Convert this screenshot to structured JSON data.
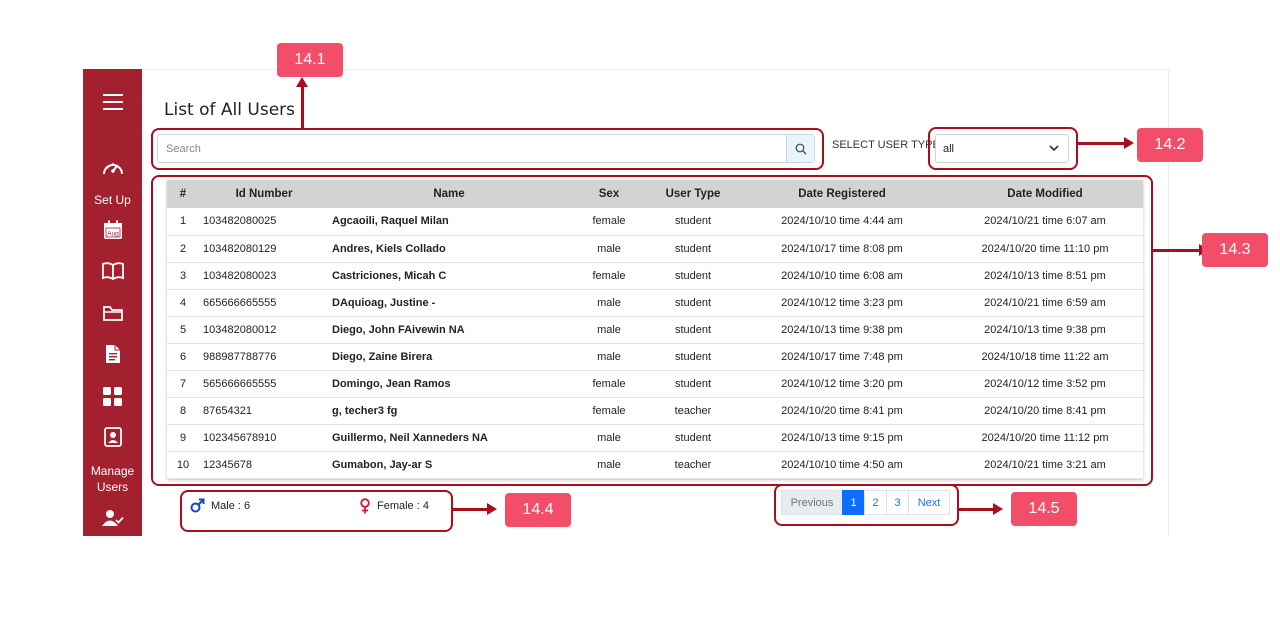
{
  "page": {
    "title": "List of All Users"
  },
  "search": {
    "placeholder": "Search"
  },
  "filter": {
    "label": "SELECT USER TYPE:",
    "selected": "all"
  },
  "sidebar": {
    "items": [
      {
        "icon": "menu-icon"
      },
      {
        "icon": "dashboard-gauge-icon",
        "label": "Set Up"
      },
      {
        "icon": "calendar-icon",
        "text": "Aug"
      },
      {
        "icon": "book-icon"
      },
      {
        "icon": "folder-icon"
      },
      {
        "icon": "document-icon"
      },
      {
        "icon": "grid-icon"
      },
      {
        "icon": "id-card-icon",
        "label": "Manage Users"
      },
      {
        "icon": "user-check-icon"
      }
    ],
    "setup_label": "Set Up",
    "calendar_text": "Aug",
    "manage_line1": "Manage",
    "manage_line2": "Users"
  },
  "table": {
    "headers": [
      "#",
      "Id Number",
      "Name",
      "Sex",
      "User Type",
      "Date Registered",
      "Date Modified"
    ],
    "rows": [
      [
        "1",
        "103482080025",
        "Agcaoili, Raquel Milan",
        "female",
        "student",
        "2024/10/10 time 4:44 am",
        "2024/10/21 time 6:07 am"
      ],
      [
        "2",
        "103482080129",
        "Andres, Kiels Collado",
        "male",
        "student",
        "2024/10/17 time 8:08 pm",
        "2024/10/20 time 11:10 pm"
      ],
      [
        "3",
        "103482080023",
        "Castriciones, Micah C",
        "female",
        "student",
        "2024/10/10 time 6:08 am",
        "2024/10/13 time 8:51 pm"
      ],
      [
        "4",
        "665666665555",
        "DAquioag, Justine -",
        "male",
        "student",
        "2024/10/12 time 3:23 pm",
        "2024/10/21 time 6:59 am"
      ],
      [
        "5",
        "103482080012",
        "Diego, John FAivewin NA",
        "male",
        "student",
        "2024/10/13 time 9:38 pm",
        "2024/10/13 time 9:38 pm"
      ],
      [
        "6",
        "988987788776",
        "Diego, Zaine Birera",
        "male",
        "student",
        "2024/10/17 time 7:48 pm",
        "2024/10/18 time 11:22 am"
      ],
      [
        "7",
        "565666665555",
        "Domingo, Jean Ramos",
        "female",
        "student",
        "2024/10/12 time 3:20 pm",
        "2024/10/12 time 3:52 pm"
      ],
      [
        "8",
        "87654321",
        "g, techer3 fg",
        "female",
        "teacher",
        "2024/10/20 time 8:41 pm",
        "2024/10/20 time 8:41 pm"
      ],
      [
        "9",
        "102345678910",
        "Guillermo, Neil Xanneders NA",
        "male",
        "student",
        "2024/10/13 time 9:15 pm",
        "2024/10/20 time 11:12 pm"
      ],
      [
        "10",
        "12345678",
        "Gumabon, Jay-ar S",
        "male",
        "teacher",
        "2024/10/10 time 4:50 am",
        "2024/10/21 time 3:21 am"
      ]
    ]
  },
  "counts": {
    "male": "Male : 6",
    "female": "Female : 4"
  },
  "pagination": {
    "previous": "Previous",
    "pages": [
      "1",
      "2",
      "3"
    ],
    "active": "1",
    "next": "Next"
  },
  "annotations": {
    "a1": "14.1",
    "a2": "14.2",
    "a3": "14.3",
    "a4": "14.4",
    "a5": "14.5"
  },
  "colors": {
    "sidebar": "#a3202f",
    "annotation_tag": "#f24e6a",
    "annotation_line": "#a80e1e",
    "active_page": "#0d6efd"
  }
}
